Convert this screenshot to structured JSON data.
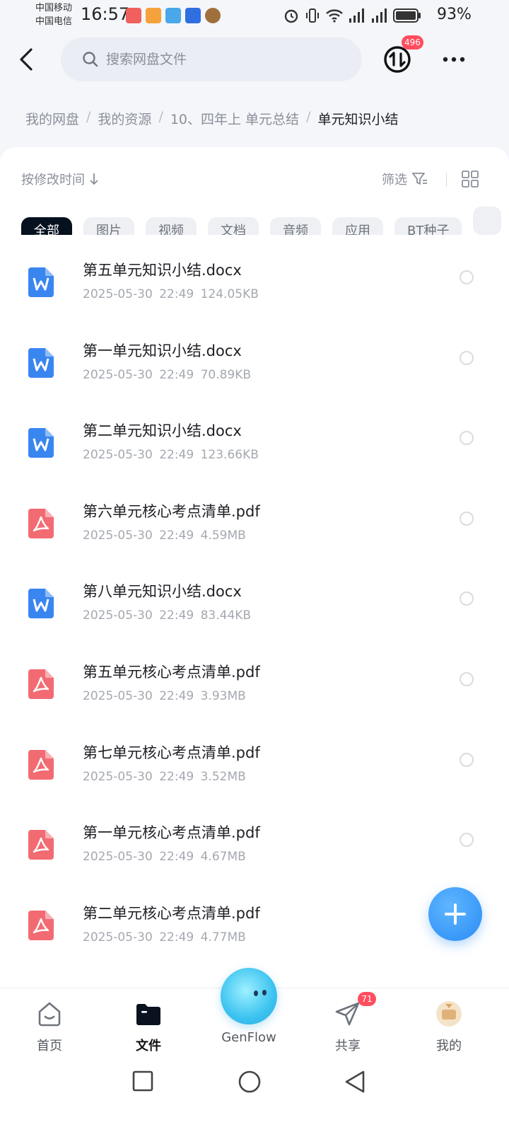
{
  "status_bar": {
    "carrier1": "中国移动",
    "carrier2": "中国电信",
    "time": "16:57",
    "battery": "93%"
  },
  "header": {
    "search_placeholder": "搜索网盘文件",
    "transfer_badge": "496"
  },
  "breadcrumb": {
    "items": [
      "我的网盘",
      "我的资源",
      "10、四年上 单元总结"
    ],
    "current": "单元知识小结"
  },
  "toolbar": {
    "sort_label": "按修改时间",
    "filter_label": "筛选"
  },
  "chips": [
    "全部",
    "图片",
    "视频",
    "文档",
    "音频",
    "应用",
    "BT种子"
  ],
  "files": [
    {
      "name": "第五单元知识小结.docx",
      "date": "2025-05-30",
      "time": "22:49",
      "size": "124.05KB",
      "type": "word"
    },
    {
      "name": "第一单元知识小结.docx",
      "date": "2025-05-30",
      "time": "22:49",
      "size": "70.89KB",
      "type": "word"
    },
    {
      "name": "第二单元知识小结.docx",
      "date": "2025-05-30",
      "time": "22:49",
      "size": "123.66KB",
      "type": "word"
    },
    {
      "name": "第六单元核心考点清单.pdf",
      "date": "2025-05-30",
      "time": "22:49",
      "size": "4.59MB",
      "type": "pdf"
    },
    {
      "name": "第八单元知识小结.docx",
      "date": "2025-05-30",
      "time": "22:49",
      "size": "83.44KB",
      "type": "word"
    },
    {
      "name": "第五单元核心考点清单.pdf",
      "date": "2025-05-30",
      "time": "22:49",
      "size": "3.93MB",
      "type": "pdf"
    },
    {
      "name": "第七单元核心考点清单.pdf",
      "date": "2025-05-30",
      "time": "22:49",
      "size": "3.52MB",
      "type": "pdf"
    },
    {
      "name": "第一单元核心考点清单.pdf",
      "date": "2025-05-30",
      "time": "22:49",
      "size": "4.67MB",
      "type": "pdf"
    },
    {
      "name": "第二单元核心考点清单.pdf",
      "date": "2025-05-30",
      "time": "22:49",
      "size": "4.77MB",
      "type": "pdf"
    }
  ],
  "bottom_nav": {
    "home": "首页",
    "files": "文件",
    "genflow": "GenFlow",
    "share": "共享",
    "share_badge": "71",
    "me": "我的"
  },
  "colors": {
    "accent": "#2a8cf5",
    "word": "#3a86f0",
    "pdf": "#f26b73",
    "badge": "#ff4d5e",
    "chip_active": "#06111f"
  }
}
